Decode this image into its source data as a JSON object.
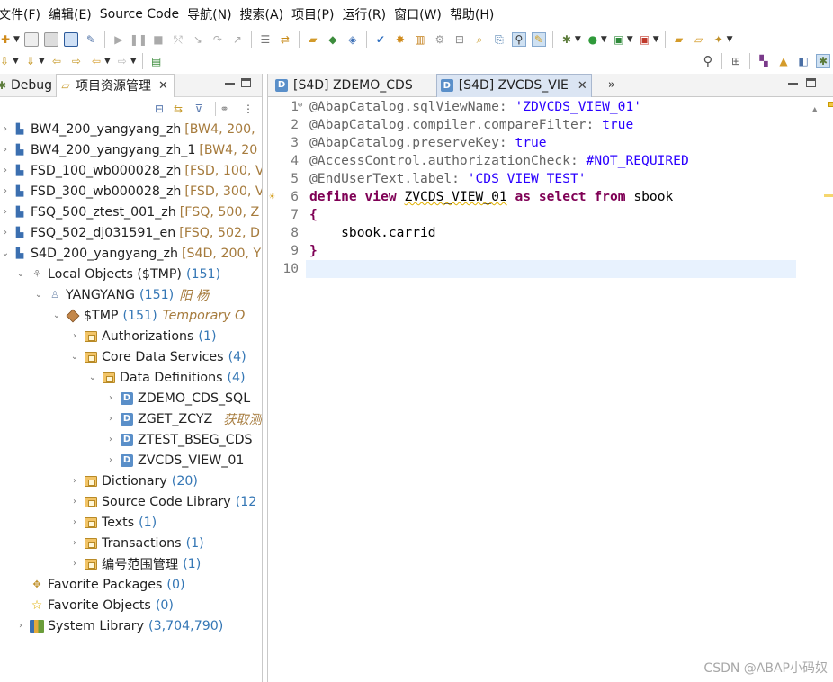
{
  "menu": [
    "文件(F)",
    "编辑(E)",
    "Source Code",
    "导航(N)",
    "搜索(A)",
    "项目(P)",
    "运行(R)",
    "窗口(W)",
    "帮助(H)"
  ],
  "left_panel": {
    "tabs": [
      {
        "label": "Debug"
      },
      {
        "label": "项目资源管理"
      }
    ],
    "tree": [
      {
        "label": "BW4_200_yangyang_zh",
        "sys": "[BW4, 200,"
      },
      {
        "label": "BW4_200_yangyang_zh_1",
        "sys": "[BW4, 20"
      },
      {
        "label": "FSD_100_wb000028_zh",
        "sys": "[FSD, 100, V"
      },
      {
        "label": "FSD_300_wb000028_zh",
        "sys": "[FSD, 300, V"
      },
      {
        "label": "FSQ_500_ztest_001_zh",
        "sys": "[FSQ, 500, Z"
      },
      {
        "label": "FSQ_502_dj031591_en",
        "sys": "[FSQ, 502, D"
      },
      {
        "label": "S4D_200_yangyang_zh",
        "sys": "[S4D, 200, Y"
      },
      {
        "label": "Local Objects ($TMP)",
        "count": "(151)"
      },
      {
        "label": "YANGYANG",
        "count": "(151)",
        "desc": "阳 杨"
      },
      {
        "label": "$TMP",
        "count": "(151)",
        "desc": "Temporary O"
      },
      {
        "label": "Authorizations",
        "count": "(1)"
      },
      {
        "label": "Core Data Services",
        "count": "(4)"
      },
      {
        "label": "Data Definitions",
        "count": "(4)"
      },
      {
        "label": "ZDEMO_CDS_SQL"
      },
      {
        "label": "ZGET_ZCYZ",
        "desc": "获取测"
      },
      {
        "label": "ZTEST_BSEG_CDS"
      },
      {
        "label": "ZVCDS_VIEW_01"
      },
      {
        "label": "Dictionary",
        "count": "(20)"
      },
      {
        "label": "Source Code Library",
        "count": "(12"
      },
      {
        "label": "Texts",
        "count": "(1)"
      },
      {
        "label": "Transactions",
        "count": "(1)"
      },
      {
        "label": "编号范围管理",
        "count": "(1)"
      },
      {
        "label": "Favorite Packages",
        "count": "(0)"
      },
      {
        "label": "Favorite Objects",
        "count": "(0)"
      },
      {
        "label": "System Library",
        "count": "(3,704,790)"
      }
    ]
  },
  "editor": {
    "tabs": [
      {
        "label": "[S4D] ZDEMO_CDS"
      },
      {
        "label": "[S4D] ZVCDS_VIE"
      }
    ],
    "more": "»",
    "line_numbers": [
      "1",
      "2",
      "3",
      "4",
      "5",
      "6",
      "7",
      "8",
      "9",
      "10"
    ],
    "code": {
      "l1a": "@AbapCatalog.sqlViewName: ",
      "l1b": "'ZDVCDS_VIEW_01'",
      "l2a": "@AbapCatalog.compiler.compareFilter: ",
      "l2b": "true",
      "l3a": "@AbapCatalog.preserveKey: ",
      "l3b": "true",
      "l4a": "@AccessControl.authorizationCheck: ",
      "l4b": "#NOT_REQUIRED",
      "l5a": "@EndUserText.label: ",
      "l5b": "'CDS VIEW TEST'",
      "l6_define": "define",
      "l6_view": "view",
      "l6_name": "ZVCDS_VIEW_01",
      "l6_as": "as",
      "l6_select": "select",
      "l6_from": "from",
      "l6_table": "sbook",
      "l7": "{",
      "l8": "    sbook.carrid",
      "l9": "}"
    }
  },
  "watermark": "CSDN @ABAP小码奴"
}
